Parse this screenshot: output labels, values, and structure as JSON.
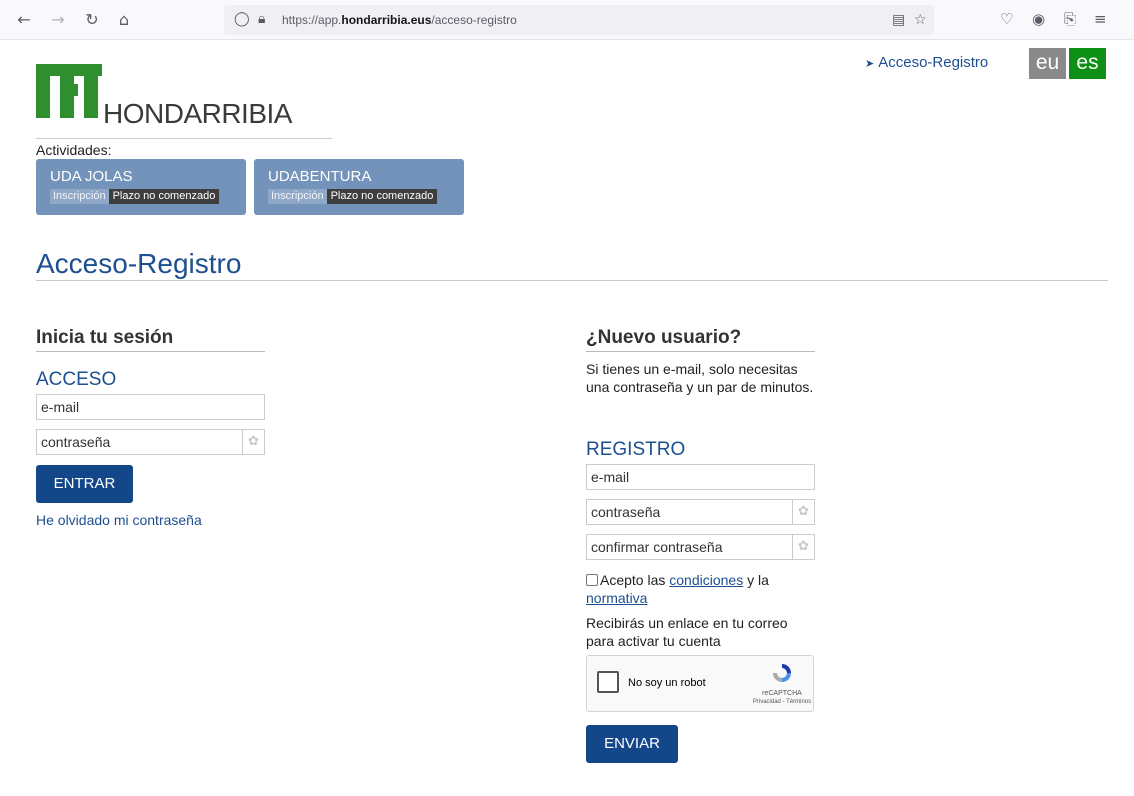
{
  "browser": {
    "url_prefix": "https://app.",
    "url_domain": "hondarribia.eus",
    "url_path": "/acceso-registro"
  },
  "header": {
    "logo_text": "HONDARRIBIA",
    "top_link": "Acceso-Registro",
    "lang_eu": "eu",
    "lang_es": "es"
  },
  "activities": {
    "label": "Actividades:",
    "items": [
      {
        "name": "UDA JOLAS",
        "tag": "Inscripción",
        "status": "Plazo no comenzado"
      },
      {
        "name": "UDABENTURA",
        "tag": "Inscripción",
        "status": "Plazo no comenzado"
      }
    ]
  },
  "page": {
    "title": "Acceso-Registro"
  },
  "login": {
    "section_title": "Inicia tu sesión",
    "subtitle": "ACCESO",
    "email_placeholder": "e-mail",
    "password_placeholder": "contraseña",
    "submit": "ENTRAR",
    "forgot": "He olvidado mi contraseña"
  },
  "register": {
    "section_title": "¿Nuevo usuario?",
    "intro": "Si tienes un e-mail, solo necesitas una contraseña y un par de minutos.",
    "subtitle": "REGISTRO",
    "email_placeholder": "e-mail",
    "password_placeholder": "contraseña",
    "confirm_placeholder": "confirmar contraseña",
    "accept_prefix": "Acepto las",
    "conditions_link": "condiciones",
    "accept_mid": "y la",
    "rules_link": "normativa",
    "activation_note": "Recibirás un enlace en tu correo para activar tu cuenta",
    "submit": "ENVIAR"
  },
  "captcha": {
    "label": "No soy un robot",
    "brand": "reCAPTCHA",
    "terms": "Privacidad - Términos"
  },
  "colors": {
    "brand_green": "#2f8f2f",
    "link_blue": "#1d4f91",
    "button_blue": "#14478a",
    "card_blue": "#7393bb",
    "lang_active": "#0e8f15",
    "lang_inactive": "#8a8a8a"
  }
}
